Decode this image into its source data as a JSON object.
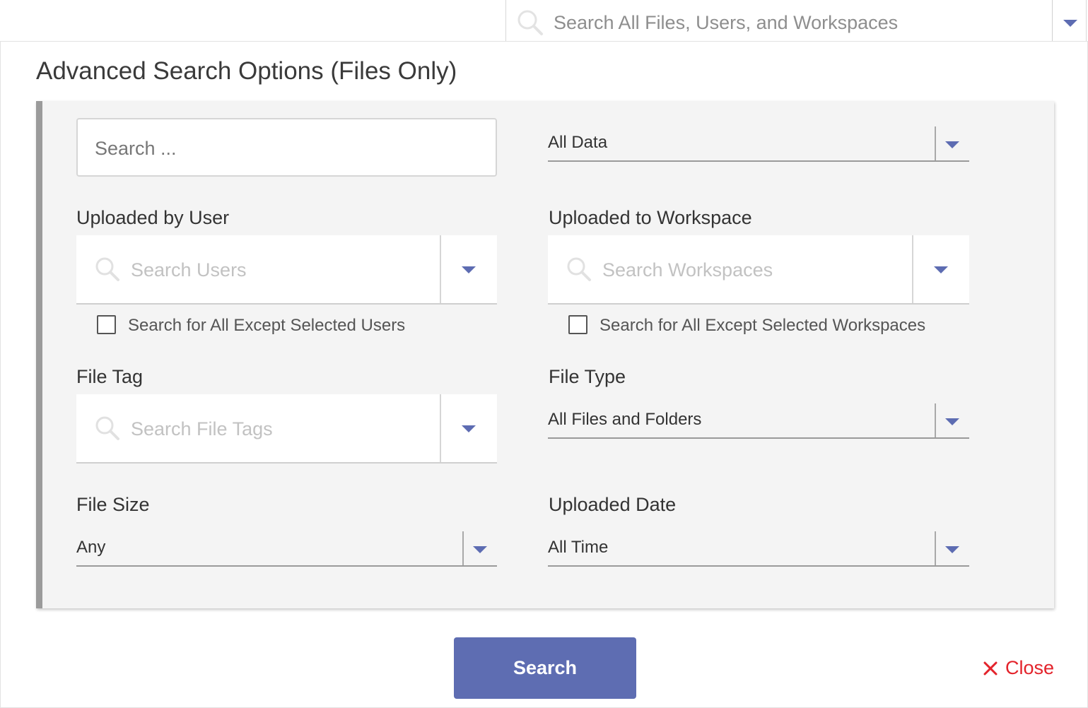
{
  "global_search": {
    "placeholder": "Search All Files, Users, and Workspaces",
    "accent": "#5d6cb2"
  },
  "modal": {
    "title": "Advanced Search Options (Files Only)",
    "keyword_placeholder": "Search ...",
    "scope_select": "All Data",
    "uploaded_by_user": {
      "label": "Uploaded by User",
      "placeholder": "Search Users",
      "except_label": "Search for All Except Selected Users",
      "except_checked": false
    },
    "uploaded_to_workspace": {
      "label": "Uploaded to Workspace",
      "placeholder": "Search Workspaces",
      "except_label": "Search for All Except Selected Workspaces",
      "except_checked": false
    },
    "file_tag": {
      "label": "File Tag",
      "placeholder": "Search File Tags"
    },
    "file_type": {
      "label": "File Type",
      "value": "All Files and Folders"
    },
    "file_size": {
      "label": "File Size",
      "value": "Any"
    },
    "uploaded_date": {
      "label": "Uploaded Date",
      "value": "All Time"
    },
    "search_button": "Search",
    "close_label": "Close",
    "close_color": "#e3232b",
    "button_color": "#5e6db2"
  }
}
